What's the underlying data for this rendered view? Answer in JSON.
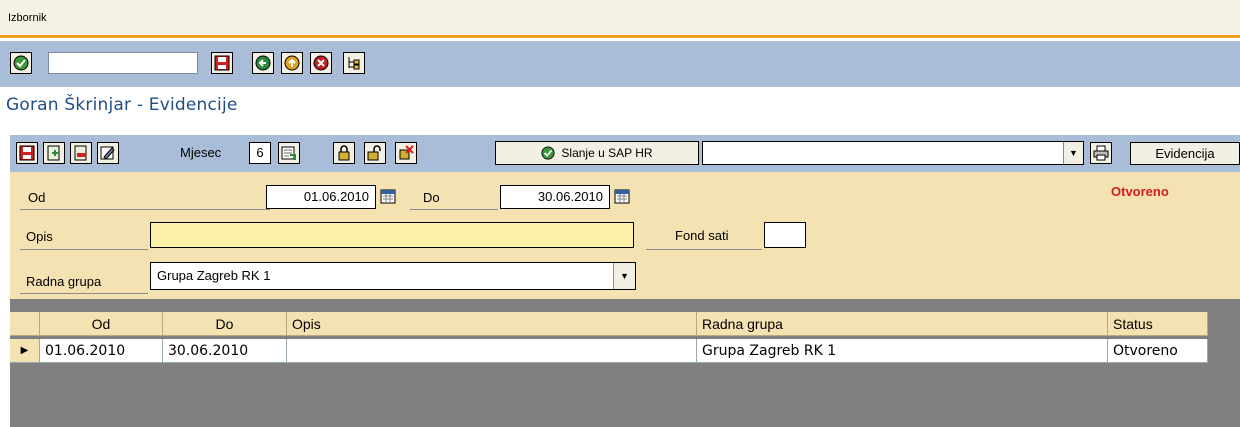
{
  "menu": {
    "label": "Izbornik"
  },
  "page": {
    "title": "Goran Škrinjar - Evidencije"
  },
  "toolbar": {
    "mjesec_label": "Mjesec",
    "mjesec_value": "6",
    "sap_button_label": "Slanje u SAP HR",
    "evidencija_button_label": "Evidencija",
    "dropdown_value": ""
  },
  "form": {
    "od_label": "Od",
    "od_value": "01.06.2010",
    "do_label": "Do",
    "do_value": "30.06.2010",
    "status_text": "Otvoreno",
    "opis_label": "Opis",
    "opis_value": "",
    "fond_sati_label": "Fond sati",
    "fond_sati_value": "",
    "radna_grupa_label": "Radna grupa",
    "radna_grupa_value": "Grupa Zagreb RK 1"
  },
  "grid": {
    "headers": [
      "Od",
      "Do",
      "Opis",
      "Radna grupa",
      "Status"
    ],
    "rows": [
      [
        "01.06.2010",
        "30.06.2010",
        "",
        "Grupa Zagreb RK 1",
        "Otvoreno"
      ]
    ]
  },
  "colors": {
    "accent_orange": "#f0a020",
    "toolbar_blue": "#a9bdd8",
    "form_tan": "#f5e2b2",
    "status_red": "#d02020",
    "title_blue": "#1f4f86"
  }
}
